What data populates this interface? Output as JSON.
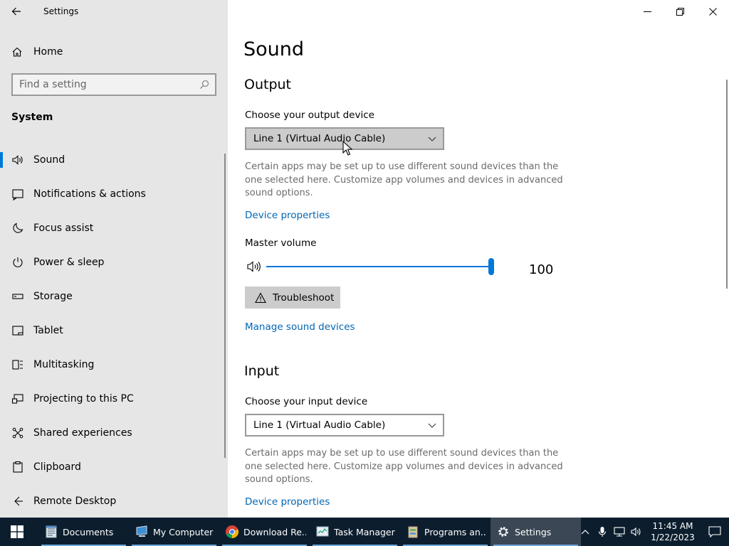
{
  "window": {
    "title": "Settings"
  },
  "sidebar": {
    "home_label": "Home",
    "search_placeholder": "Find a setting",
    "section": "System",
    "items": [
      {
        "label": "Sound",
        "icon": "speaker-icon",
        "active": true
      },
      {
        "label": "Notifications & actions",
        "icon": "notification-icon"
      },
      {
        "label": "Focus assist",
        "icon": "moon-icon"
      },
      {
        "label": "Power & sleep",
        "icon": "power-icon"
      },
      {
        "label": "Storage",
        "icon": "storage-icon"
      },
      {
        "label": "Tablet",
        "icon": "tablet-icon"
      },
      {
        "label": "Multitasking",
        "icon": "multitasking-icon"
      },
      {
        "label": "Projecting to this PC",
        "icon": "projecting-icon"
      },
      {
        "label": "Shared experiences",
        "icon": "shared-icon"
      },
      {
        "label": "Clipboard",
        "icon": "clipboard-icon"
      },
      {
        "label": "Remote Desktop",
        "icon": "remote-desktop-icon"
      }
    ]
  },
  "main": {
    "title": "Sound",
    "output": {
      "heading": "Output",
      "device_label": "Choose your output device",
      "device_value": "Line 1 (Virtual Audio Cable)",
      "description": "Certain apps may be set up to use different sound devices than the one selected here. Customize app volumes and devices in advanced sound options.",
      "device_properties": "Device properties",
      "volume_label": "Master volume",
      "volume_value": "100",
      "volume_level": 1.0,
      "troubleshoot": "Troubleshoot",
      "manage_devices": "Manage sound devices"
    },
    "input": {
      "heading": "Input",
      "device_label": "Choose your input device",
      "device_value": "Line 1 (Virtual Audio Cable)",
      "description": "Certain apps may be set up to use different sound devices than the one selected here. Customize app volumes and devices in advanced sound options.",
      "device_properties": "Device properties"
    }
  },
  "taskbar": {
    "apps": [
      {
        "label": "Documents",
        "icon": "notepad-icon"
      },
      {
        "label": "My Computer",
        "icon": "computer-icon"
      },
      {
        "label": "Download Re...",
        "icon": "chrome-icon"
      },
      {
        "label": "Task Manager",
        "icon": "task-manager-icon"
      },
      {
        "label": "Programs an...",
        "icon": "programs-icon"
      },
      {
        "label": "Settings",
        "icon": "gear-icon",
        "active": true
      }
    ],
    "time": "11:45 AM",
    "date": "1/22/2023"
  },
  "colors": {
    "accent": "#0078d7",
    "link": "#0066b4",
    "sidebar_bg": "#e6e6e6",
    "taskbar_bg": "#0c1e2e"
  }
}
